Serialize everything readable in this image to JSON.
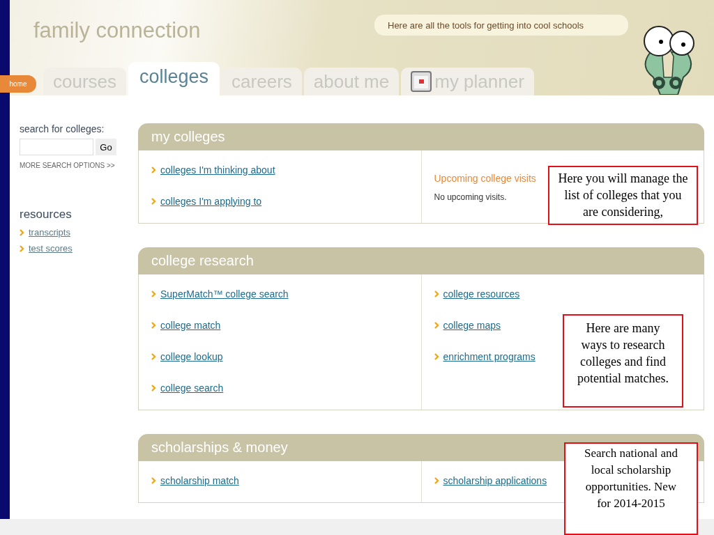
{
  "header": {
    "title": "family connection",
    "speech_bubble": "Here are all the tools for getting into cool schools",
    "home_button": "home",
    "tabs": [
      {
        "label": "courses",
        "selected": false,
        "kind": "text"
      },
      {
        "label": "colleges",
        "selected": true,
        "kind": "text"
      },
      {
        "label": "careers",
        "selected": false,
        "kind": "text"
      },
      {
        "label": "about me",
        "selected": false,
        "kind": "text"
      },
      {
        "label": "my planner",
        "selected": false,
        "kind": "planner"
      }
    ]
  },
  "sidebar": {
    "search_label": "search for colleges:",
    "search_button": "Go",
    "more_options": "MORE SEARCH OPTIONS >>",
    "resources_title": "resources",
    "resources": [
      "transcripts",
      "test scores"
    ]
  },
  "panels": [
    {
      "title": "my colleges",
      "columns": [
        [
          {
            "kind": "link",
            "text": "colleges I'm thinking about"
          },
          {
            "kind": "link",
            "text": "colleges I'm applying to"
          }
        ],
        [
          {
            "kind": "heading",
            "text": "Upcoming college visits"
          },
          {
            "kind": "note",
            "text": "No upcoming visits."
          }
        ]
      ]
    },
    {
      "title": "college research",
      "columns": [
        [
          {
            "kind": "link",
            "text": "SuperMatch™ college search"
          },
          {
            "kind": "link",
            "text": "college match"
          },
          {
            "kind": "link",
            "text": "college lookup"
          },
          {
            "kind": "link",
            "text": "college search"
          }
        ],
        [
          {
            "kind": "link",
            "text": "college resources"
          },
          {
            "kind": "link",
            "text": "college maps"
          },
          {
            "kind": "link",
            "text": "enrichment programs"
          }
        ]
      ]
    },
    {
      "title": "scholarships & money",
      "columns": [
        [
          {
            "kind": "link",
            "text": "scholarship match"
          }
        ],
        [
          {
            "kind": "link",
            "text": "scholarship applications"
          }
        ]
      ]
    }
  ],
  "callouts": [
    "Here you will manage the list of colleges that you are considering,",
    "Here are many ways to research colleges and find potential matches.",
    "Search national and local scholarship opportunities. New for 2014-2015"
  ]
}
